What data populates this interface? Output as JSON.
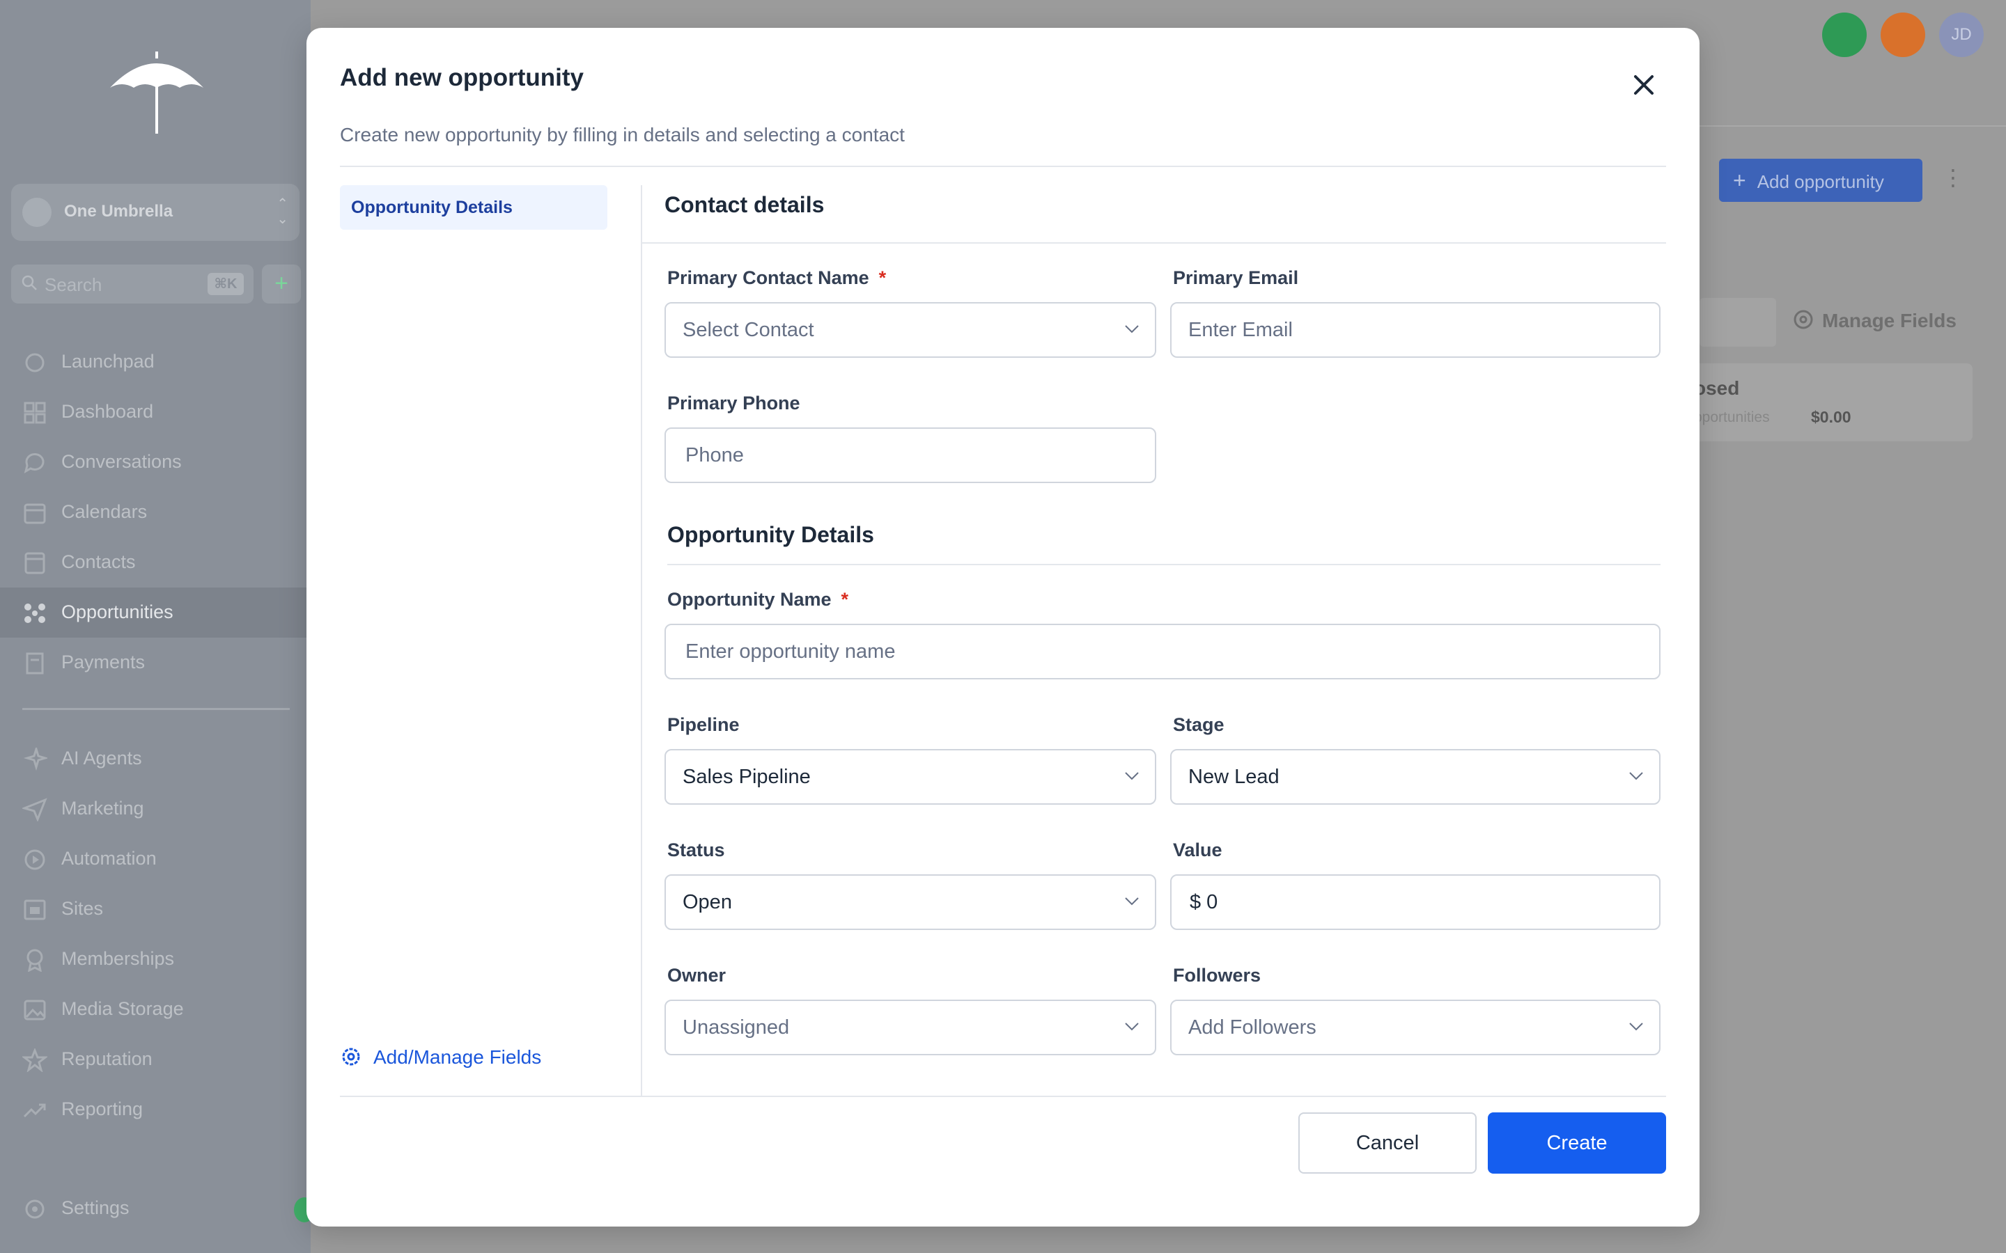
{
  "sidebar": {
    "location_name": "One Umbrella",
    "search_placeholder": "Search",
    "search_shortcut": "⌘K",
    "quick_add": "+",
    "nav_items": [
      {
        "label": "Launchpad",
        "icon": "rocket-icon"
      },
      {
        "label": "Dashboard",
        "icon": "grid-icon"
      },
      {
        "label": "Conversations",
        "icon": "chat-icon"
      },
      {
        "label": "Calendars",
        "icon": "calendar-icon"
      },
      {
        "label": "Contacts",
        "icon": "contact-card-icon"
      },
      {
        "label": "Opportunities",
        "icon": "opportunities-icon",
        "active": true
      },
      {
        "label": "Payments",
        "icon": "receipt-icon"
      }
    ],
    "nav_items_2": [
      {
        "label": "AI Agents",
        "icon": "sparkles-icon"
      },
      {
        "label": "Marketing",
        "icon": "send-icon"
      },
      {
        "label": "Automation",
        "icon": "automation-icon"
      },
      {
        "label": "Sites",
        "icon": "sites-icon"
      },
      {
        "label": "Memberships",
        "icon": "badge-icon"
      },
      {
        "label": "Media Storage",
        "icon": "image-icon"
      },
      {
        "label": "Reputation",
        "icon": "star-icon"
      },
      {
        "label": "Reporting",
        "icon": "trending-up-icon"
      }
    ],
    "settings_label": "Settings"
  },
  "header": {
    "avatar_initials": "JD",
    "add_opportunity_label": "Add opportunity",
    "manage_fields_label": "Manage Fields",
    "card_title": "osed",
    "card_subtitle": "pportunities",
    "card_value": "$0.00"
  },
  "modal": {
    "title": "Add new opportunity",
    "subtitle": "Create new opportunity by filling in details and selecting a contact",
    "left_tab": "Opportunity Details",
    "manage_fields_link": "Add/Manage Fields",
    "contact_section": {
      "title": "Contact details",
      "primary_contact_label": "Primary Contact Name",
      "primary_contact_placeholder": "Select Contact",
      "primary_email_label": "Primary Email",
      "primary_email_placeholder": "Enter Email",
      "primary_phone_label": "Primary Phone",
      "primary_phone_placeholder": "Phone"
    },
    "opportunity_section": {
      "title": "Opportunity Details",
      "name_label": "Opportunity Name",
      "name_placeholder": "Enter opportunity name",
      "pipeline_label": "Pipeline",
      "pipeline_value": "Sales Pipeline",
      "stage_label": "Stage",
      "stage_value": "New Lead",
      "status_label": "Status",
      "status_value": "Open",
      "value_label": "Value",
      "value_value": "$ 0",
      "owner_label": "Owner",
      "owner_value": "Unassigned",
      "followers_label": "Followers",
      "followers_placeholder": "Add Followers"
    },
    "required_marker": "*",
    "cancel_label": "Cancel",
    "create_label": "Create"
  },
  "colors": {
    "primary": "#155eef",
    "link": "#1a56db",
    "required": "#d92d20"
  }
}
